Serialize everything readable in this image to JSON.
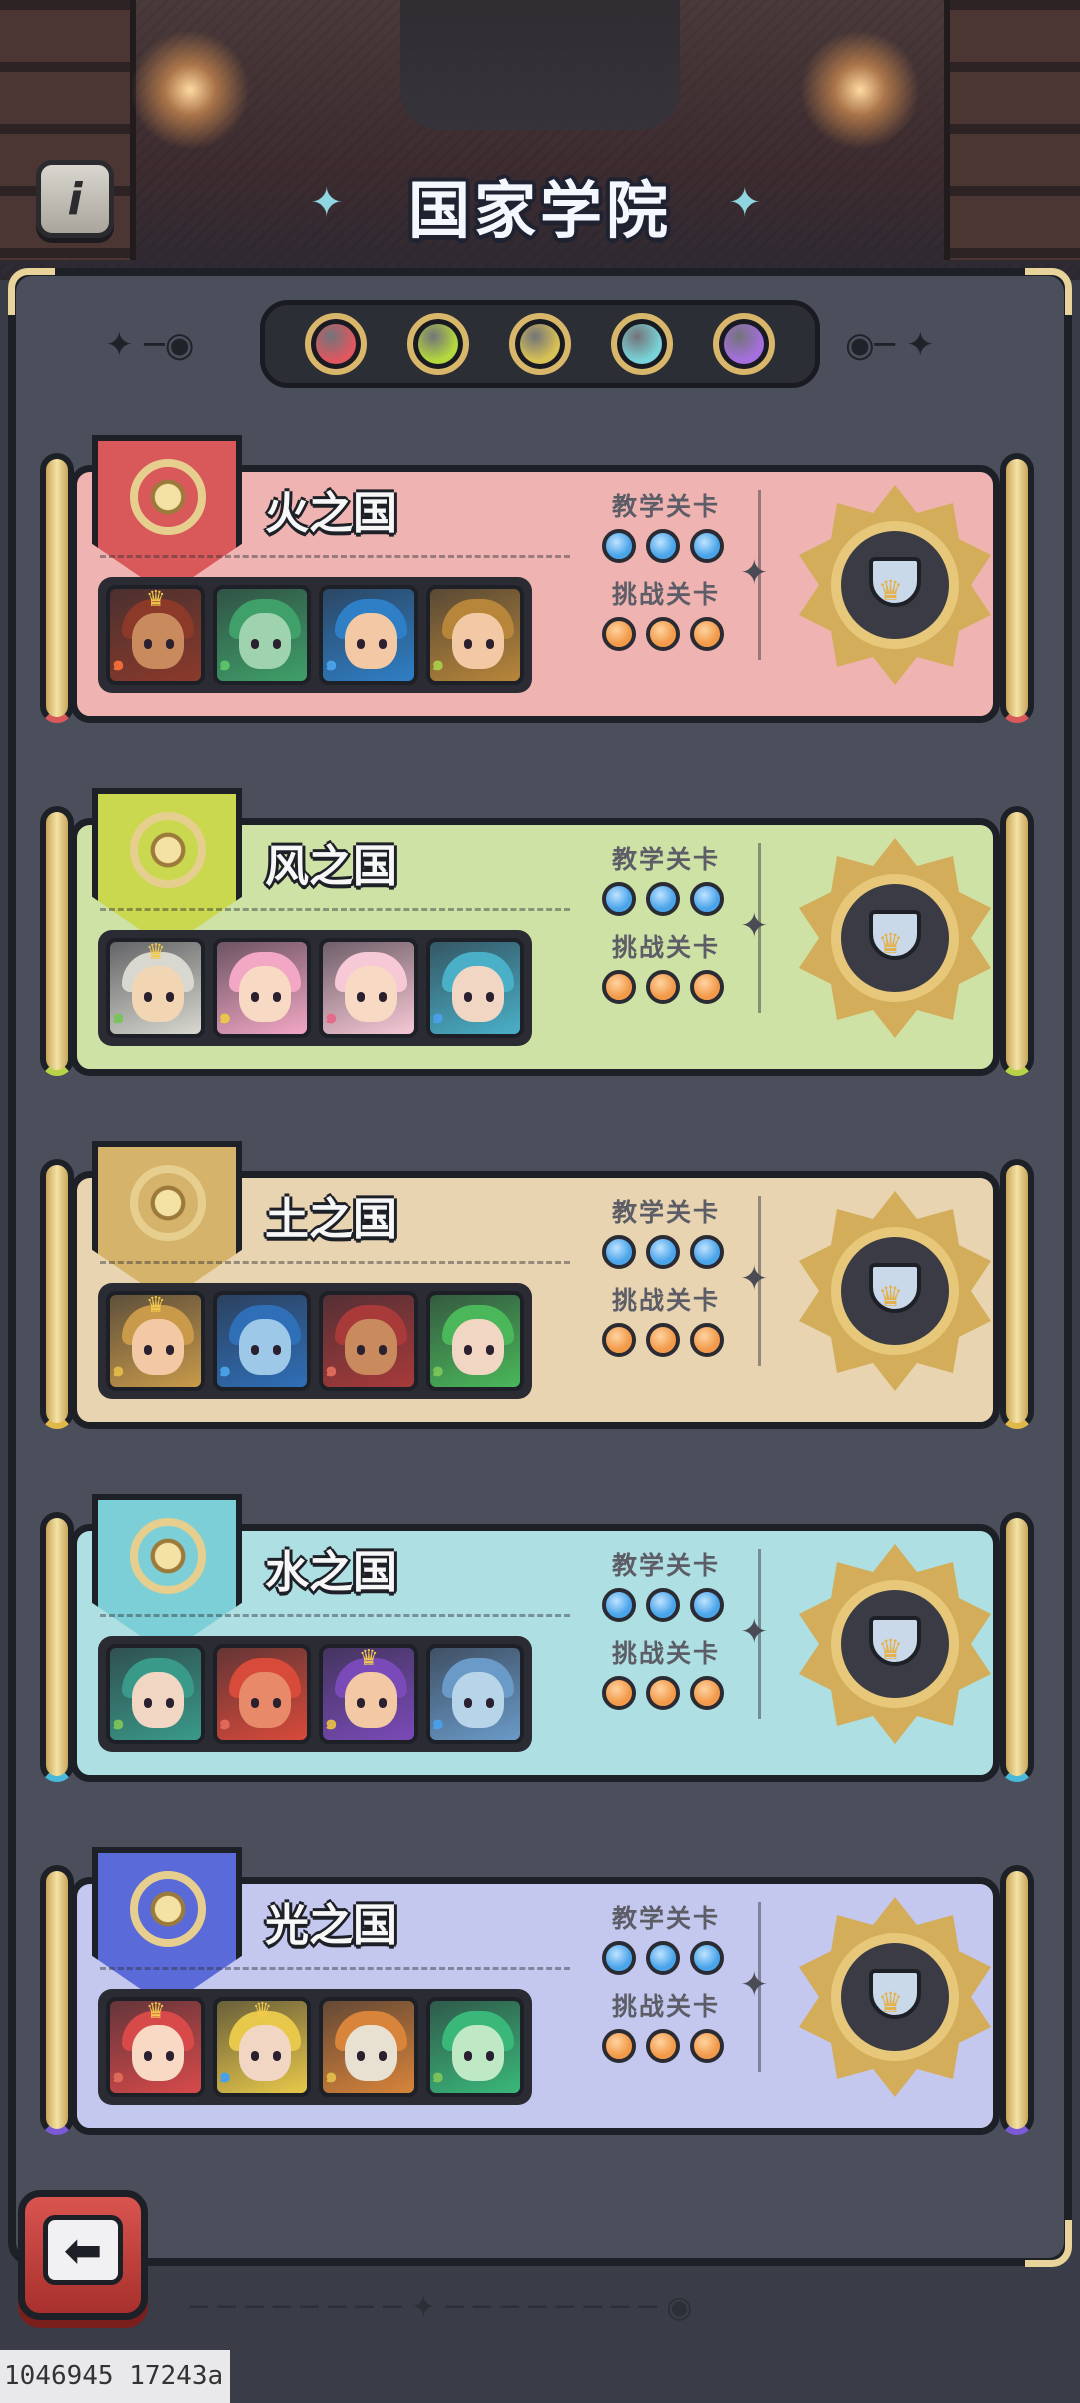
{
  "page": {
    "title": "国家学院",
    "info_icon": "i"
  },
  "element_orbs": [
    {
      "name": "fire",
      "color": "#e0575f"
    },
    {
      "name": "wind",
      "color": "#b5d83e"
    },
    {
      "name": "earth",
      "color": "#d8c255"
    },
    {
      "name": "water",
      "color": "#79d3d8"
    },
    {
      "name": "light",
      "color": "#a66fe0"
    }
  ],
  "labels": {
    "teach": "教学关卡",
    "challenge": "挑战关卡"
  },
  "countries": [
    {
      "name": "火之国",
      "bg": "#efb4b2",
      "shield": "#d9595a",
      "scroll_accent": "#d9595a",
      "heroes": [
        {
          "hair": "#8b3a2a",
          "skin": "#c98a5e",
          "elem": "#f06c3a",
          "crown": true
        },
        {
          "hair": "#3fa06a",
          "skin": "#9fd3b0",
          "elem": "#5bc26a",
          "crown": false
        },
        {
          "hair": "#2f7fc6",
          "skin": "#f2c9a4",
          "elem": "#4aa0e8",
          "crown": false
        },
        {
          "hair": "#b8863a",
          "skin": "#f2c9a4",
          "elem": "#a8c84a",
          "crown": false
        }
      ]
    },
    {
      "name": "风之国",
      "bg": "#cfe2a6",
      "shield": "#c9d84e",
      "scroll_accent": "#b8d34a",
      "heroes": [
        {
          "hair": "#d8d8d0",
          "skin": "#f2d6b4",
          "elem": "#7ac25a",
          "crown": true
        },
        {
          "hair": "#f2a7c4",
          "skin": "#f7d9c4",
          "elem": "#e8c84a",
          "crown": false
        },
        {
          "hair": "#f7c8d6",
          "skin": "#f7d9c4",
          "elem": "#e46a8a",
          "crown": false
        },
        {
          "hair": "#4ab0c8",
          "skin": "#f2d6c4",
          "elem": "#4aa0e8",
          "crown": false
        }
      ]
    },
    {
      "name": "土之国",
      "bg": "#e8d4b0",
      "shield": "#d6b36a",
      "scroll_accent": "#e0b84a",
      "heroes": [
        {
          "hair": "#c89a4a",
          "skin": "#f2c9a4",
          "elem": "#e0b84a",
          "crown": true
        },
        {
          "hair": "#2f6fb8",
          "skin": "#9ec8e8",
          "elem": "#4aa0e8",
          "crown": false
        },
        {
          "hair": "#a83a3a",
          "skin": "#c98a5e",
          "elem": "#e06a5a",
          "crown": false
        },
        {
          "hair": "#4ab85a",
          "skin": "#f2d6c4",
          "elem": "#7ac25a",
          "crown": false
        }
      ]
    },
    {
      "name": "水之国",
      "bg": "#aedfe2",
      "shield": "#7ccfd6",
      "scroll_accent": "#4ab8d8",
      "heroes": [
        {
          "hair": "#3a9a8a",
          "skin": "#f2d6c4",
          "elem": "#7ac25a",
          "crown": false
        },
        {
          "hair": "#d84a3a",
          "skin": "#e88a6a",
          "elem": "#e06a5a",
          "crown": false
        },
        {
          "hair": "#7a4ab8",
          "skin": "#f2c9a4",
          "elem": "#e0b84a",
          "crown": true
        },
        {
          "hair": "#6a9ac8",
          "skin": "#b8d4e8",
          "elem": "#4aa0e8",
          "crown": false
        }
      ]
    },
    {
      "name": "光之国",
      "bg": "#c4c8ee",
      "shield": "#5a6ad8",
      "scroll_accent": "#7a5ad8",
      "heroes": [
        {
          "hair": "#d84a4a",
          "skin": "#f7d9c4",
          "elem": "#e06a5a",
          "crown": true
        },
        {
          "hair": "#e8c84a",
          "skin": "#f2d6c4",
          "elem": "#4aa0e8",
          "crown": true
        },
        {
          "hair": "#d8843a",
          "skin": "#e8e0d0",
          "elem": "#e0b84a",
          "crown": false
        },
        {
          "hair": "#3ab87a",
          "skin": "#bfe8c4",
          "elem": "#7ac25a",
          "crown": false
        }
      ]
    }
  ],
  "footer": {
    "text": "1046945 17243a"
  }
}
